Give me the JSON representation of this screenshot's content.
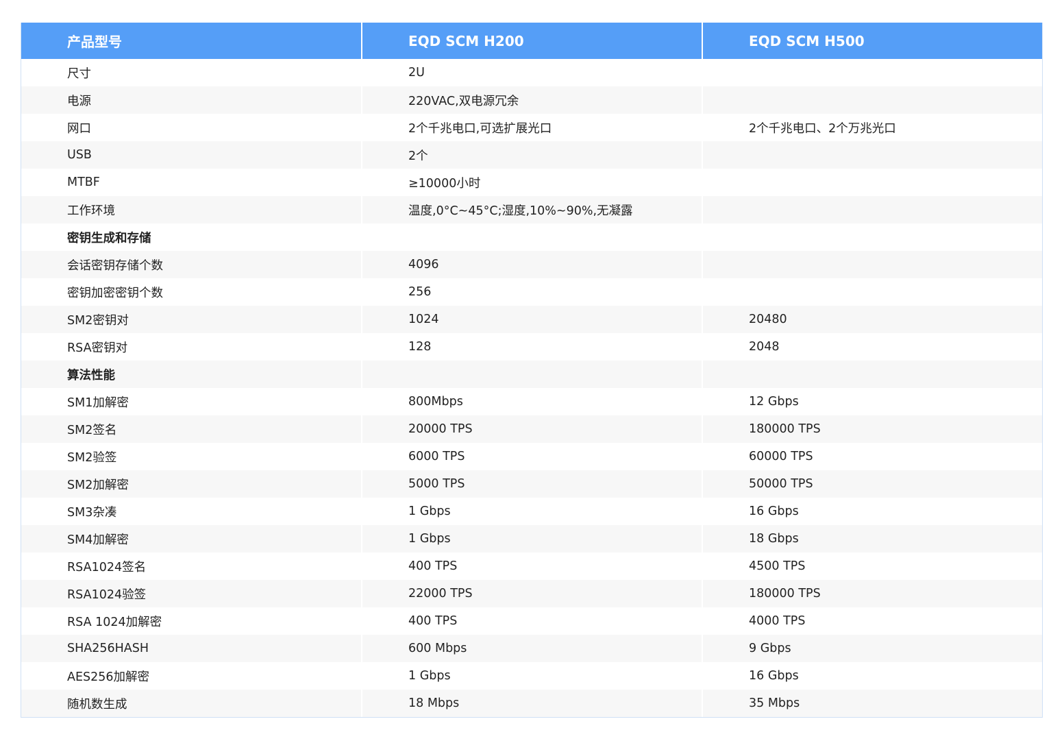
{
  "header": {
    "col1": "产品型号",
    "col2": "EQD SCM H200",
    "col3": "EQD SCM H500"
  },
  "rows": [
    {
      "type": "row",
      "label": "尺寸",
      "h200": "2U",
      "h500": ""
    },
    {
      "type": "row",
      "label": "电源",
      "h200": "220VAC,双电源冗余",
      "h500": ""
    },
    {
      "type": "row",
      "label": "网口",
      "h200": "2个千兆电口,可选扩展光口",
      "h500": "2个千兆电口、2个万兆光口"
    },
    {
      "type": "row",
      "label": "USB",
      "h200": "2个",
      "h500": ""
    },
    {
      "type": "row",
      "label": "MTBF",
      "h200": "≥10000小时",
      "h500": ""
    },
    {
      "type": "row",
      "label": "工作环境",
      "h200": "温度,0°C~45°C;湿度,10%~90%,无凝露",
      "h500": ""
    },
    {
      "type": "section",
      "label": "密钥生成和存储",
      "h200": "",
      "h500": ""
    },
    {
      "type": "row",
      "label": "会话密钥存储个数",
      "h200": "4096",
      "h500": ""
    },
    {
      "type": "row",
      "label": "密钥加密密钥个数",
      "h200": "256",
      "h500": ""
    },
    {
      "type": "row",
      "label": "SM2密钥对",
      "h200": "1024",
      "h500": "20480"
    },
    {
      "type": "row",
      "label": "RSA密钥对",
      "h200": "128",
      "h500": "2048"
    },
    {
      "type": "section",
      "label": "算法性能",
      "h200": "",
      "h500": ""
    },
    {
      "type": "row",
      "label": "SM1加解密",
      "h200": "800Mbps",
      "h500": "12 Gbps"
    },
    {
      "type": "row",
      "label": "SM2签名",
      "h200": "20000 TPS",
      "h500": "180000 TPS"
    },
    {
      "type": "row",
      "label": "SM2验签",
      "h200": "6000 TPS",
      "h500": "60000 TPS"
    },
    {
      "type": "row",
      "label": "SM2加解密",
      "h200": "5000 TPS",
      "h500": "50000 TPS"
    },
    {
      "type": "row",
      "label": "SM3杂凑",
      "h200": "1 Gbps",
      "h500": "16 Gbps"
    },
    {
      "type": "row",
      "label": "SM4加解密",
      "h200": "1 Gbps",
      "h500": "18 Gbps"
    },
    {
      "type": "row",
      "label": "RSA1024签名",
      "h200": "400 TPS",
      "h500": "4500 TPS"
    },
    {
      "type": "row",
      "label": "RSA1024验签",
      "h200": "22000 TPS",
      "h500": "180000 TPS"
    },
    {
      "type": "row",
      "label": "RSA 1024加解密",
      "h200": "400 TPS",
      "h500": "4000 TPS"
    },
    {
      "type": "row",
      "label": "SHA256HASH",
      "h200": "600 Mbps",
      "h500": "9 Gbps"
    },
    {
      "type": "row",
      "label": "AES256加解密",
      "h200": "1 Gbps",
      "h500": "16 Gbps"
    },
    {
      "type": "row",
      "label": "随机数生成",
      "h200": "18 Mbps",
      "h500": "35 Mbps"
    }
  ],
  "colors": {
    "header_bg": "#559ef7",
    "header_text": "#ffffff",
    "row_alt_bg": "#f7f7f7",
    "border": "#cfe0f5"
  }
}
